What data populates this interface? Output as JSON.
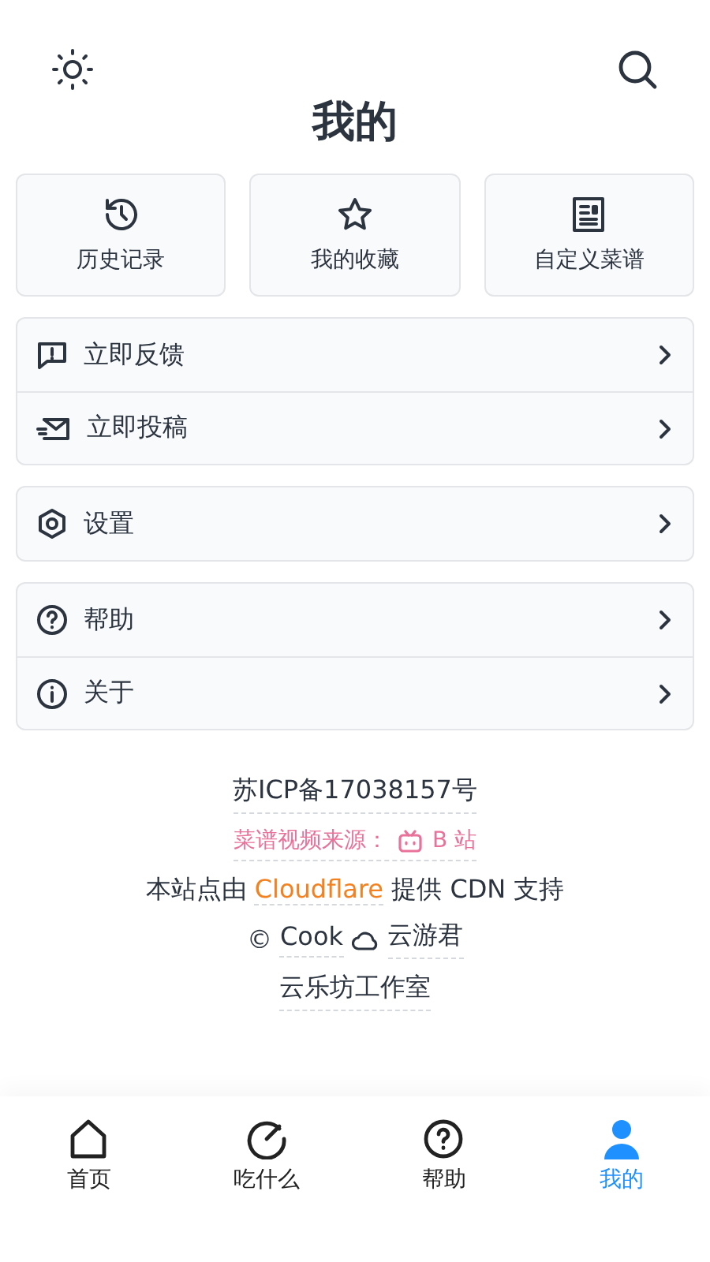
{
  "header": {
    "title": "我的"
  },
  "quick_actions": [
    {
      "label": "历史记录"
    },
    {
      "label": "我的收藏"
    },
    {
      "label": "自定义菜谱"
    }
  ],
  "menu_groups": [
    {
      "items": [
        {
          "label": "立即反馈"
        },
        {
          "label": "立即投稿"
        }
      ]
    },
    {
      "items": [
        {
          "label": "设置"
        }
      ]
    },
    {
      "items": [
        {
          "label": "帮助"
        },
        {
          "label": "关于"
        }
      ]
    }
  ],
  "footer": {
    "icp": "苏ICP备17038157号",
    "video_source": "菜谱视频来源：",
    "video_site": "B 站",
    "cdn_before": "本站点由 ",
    "cdn_link": "Cloudflare",
    "cdn_after": " 提供 CDN 支持",
    "copyright": "©",
    "author": "Cook",
    "author2": "云游君",
    "studio": "云乐坊工作室"
  },
  "bottom_nav": [
    {
      "label": "首页",
      "selected": false
    },
    {
      "label": "吃什么",
      "selected": false
    },
    {
      "label": "帮助",
      "selected": false
    },
    {
      "label": "我的",
      "selected": true
    }
  ]
}
